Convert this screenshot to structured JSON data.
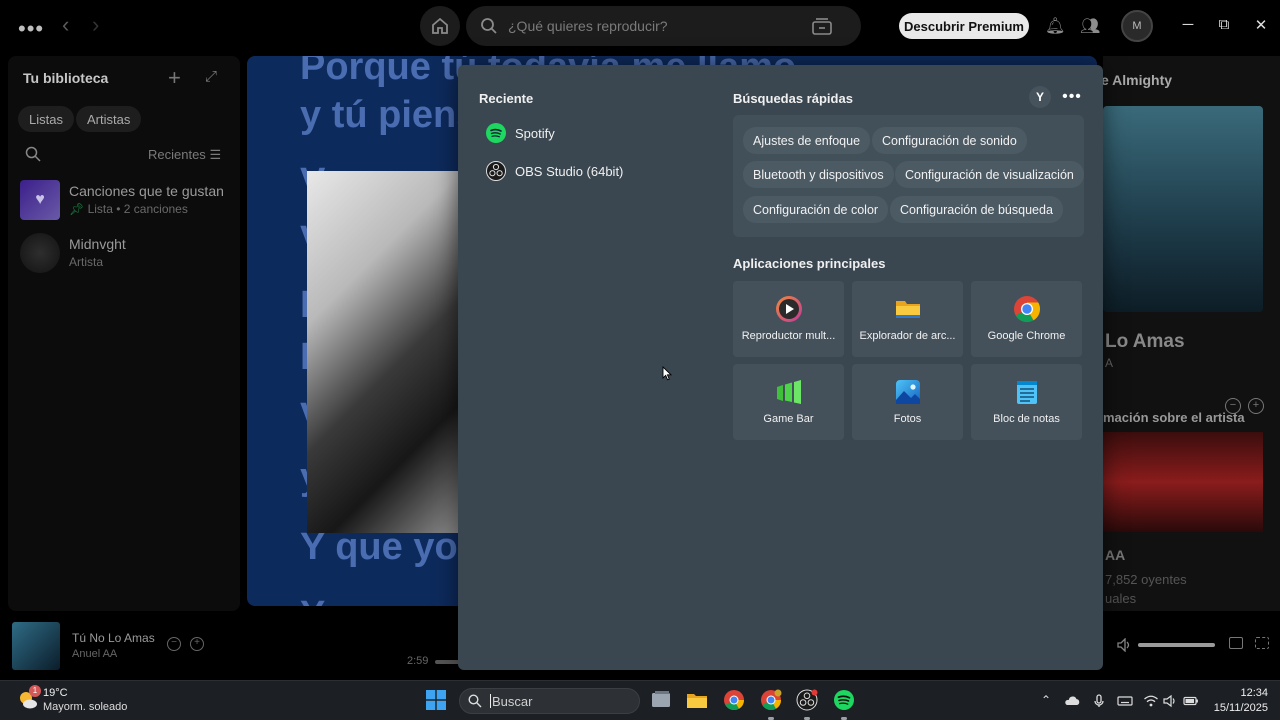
{
  "spotify": {
    "search_placeholder": "¿Qué quieres reproducir?",
    "premium_button": "Descubrir Premium",
    "profile_initial": "M",
    "library": {
      "title": "Tu biblioteca",
      "filters": [
        "Listas",
        "Artistas"
      ],
      "sort_label": "Recientes",
      "items": [
        {
          "name": "Canciones que te gustan",
          "sub": "Lista • 2 canciones"
        },
        {
          "name": "Midnvght",
          "sub": "Artista"
        }
      ]
    },
    "lyrics": [
      "Porque tú todavía me llamo",
      "y tú piens",
      "V",
      "V",
      "I",
      "I",
      "V",
      "y",
      "Y que yo s",
      "Y "
    ],
    "right_panel": {
      "title": "e Almighty",
      "song": "Lo Amas",
      "song_artist": "A",
      "about_title": "mación sobre el artista",
      "artist": "AA",
      "listeners": "7,852 oyentes",
      "listeners_cont": "uales"
    },
    "now_playing": {
      "title": "Tú No Lo Amas",
      "artist": "Anuel AA",
      "time": "2:59"
    }
  },
  "start_menu": {
    "recent_title": "Reciente",
    "recent": [
      {
        "label": "Spotify",
        "icon": "spotify-icon"
      },
      {
        "label": "OBS Studio (64bit)",
        "icon": "obs-icon"
      }
    ],
    "quick_title": "Búsquedas rápidas",
    "user_initial": "Y",
    "quick_searches": [
      "Ajustes de enfoque",
      "Configuración de sonido",
      "Bluetooth y dispositivos",
      "Configuración de visualización",
      "Configuración de color",
      "Configuración de búsqueda"
    ],
    "apps_title": "Aplicaciones principales",
    "apps": [
      {
        "label": "Reproductor mult...",
        "icon": "media-player-icon"
      },
      {
        "label": "Explorador de arc...",
        "icon": "file-explorer-icon"
      },
      {
        "label": "Google Chrome",
        "icon": "chrome-icon"
      },
      {
        "label": "Game Bar",
        "icon": "game-bar-icon"
      },
      {
        "label": "Fotos",
        "icon": "photos-icon"
      },
      {
        "label": "Bloc de notas",
        "icon": "notepad-icon"
      }
    ]
  },
  "taskbar": {
    "weather_badge": "1",
    "temperature": "19°C",
    "condition": "Mayorm. soleado",
    "search_placeholder": "Buscar",
    "time": "12:34",
    "date": "15/11/2025"
  },
  "colors": {
    "spotify_green": "#1ed760",
    "start_menu_bg": "#3a4750",
    "taskbar_bg": "#1c1f23",
    "lyrics_bg": "#0d2a5c"
  }
}
